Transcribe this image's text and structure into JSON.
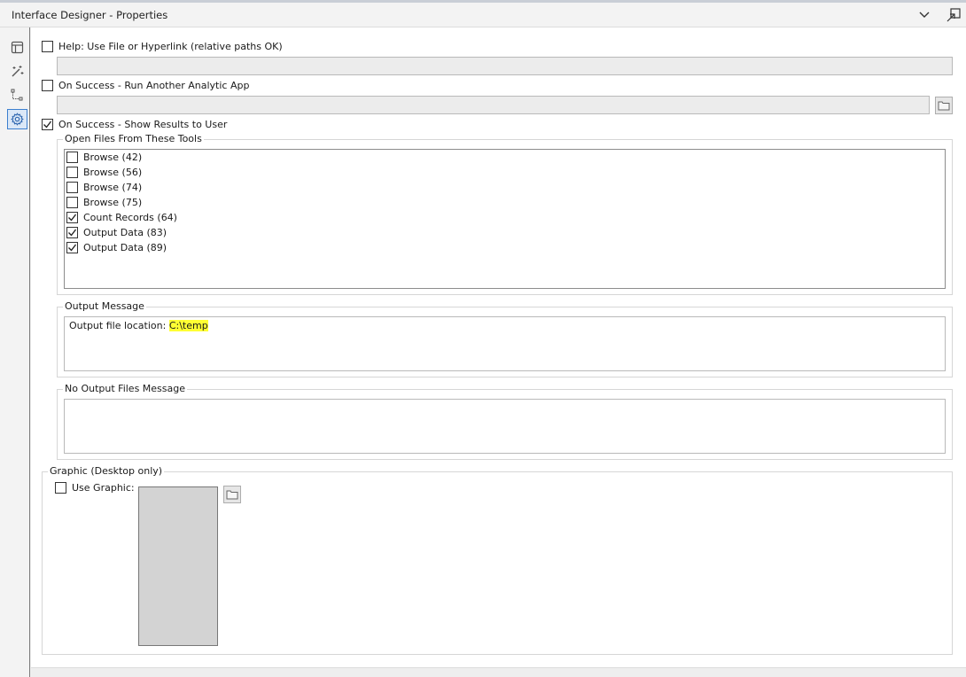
{
  "window": {
    "title": "Interface Designer - Properties"
  },
  "help": {
    "label": "Help: Use File or Hyperlink (relative paths OK)",
    "checked": false,
    "value": ""
  },
  "run_app": {
    "label": "On Success - Run Another Analytic App",
    "checked": false,
    "value": ""
  },
  "show_results": {
    "label": "On Success - Show Results to User",
    "checked": true,
    "open_files_group": "Open Files From These Tools",
    "tools": [
      {
        "label": "Browse (42)",
        "checked": false
      },
      {
        "label": "Browse (56)",
        "checked": false
      },
      {
        "label": "Browse (74)",
        "checked": false
      },
      {
        "label": "Browse (75)",
        "checked": false
      },
      {
        "label": "Count Records (64)",
        "checked": true
      },
      {
        "label": "Output Data (83)",
        "checked": true
      },
      {
        "label": "Output Data (89)",
        "checked": true
      }
    ],
    "output_message_group": "Output Message",
    "output_message_prefix": "Output file location: ",
    "output_message_highlight": "C:\\temp",
    "no_output_group": "No Output Files Message",
    "no_output_value": ""
  },
  "graphic": {
    "group": "Graphic (Desktop only)",
    "label": "Use Graphic:",
    "checked": false
  },
  "icons": {
    "rail": [
      "layout-icon",
      "magic-wand-icon",
      "tree-icon",
      "gear-icon"
    ],
    "title": [
      "chevron-down-icon",
      "undock-icon"
    ],
    "browse": "folder-icon"
  },
  "colors": {
    "highlight": "#ffff33",
    "active_rail": "#3c7fcf"
  }
}
